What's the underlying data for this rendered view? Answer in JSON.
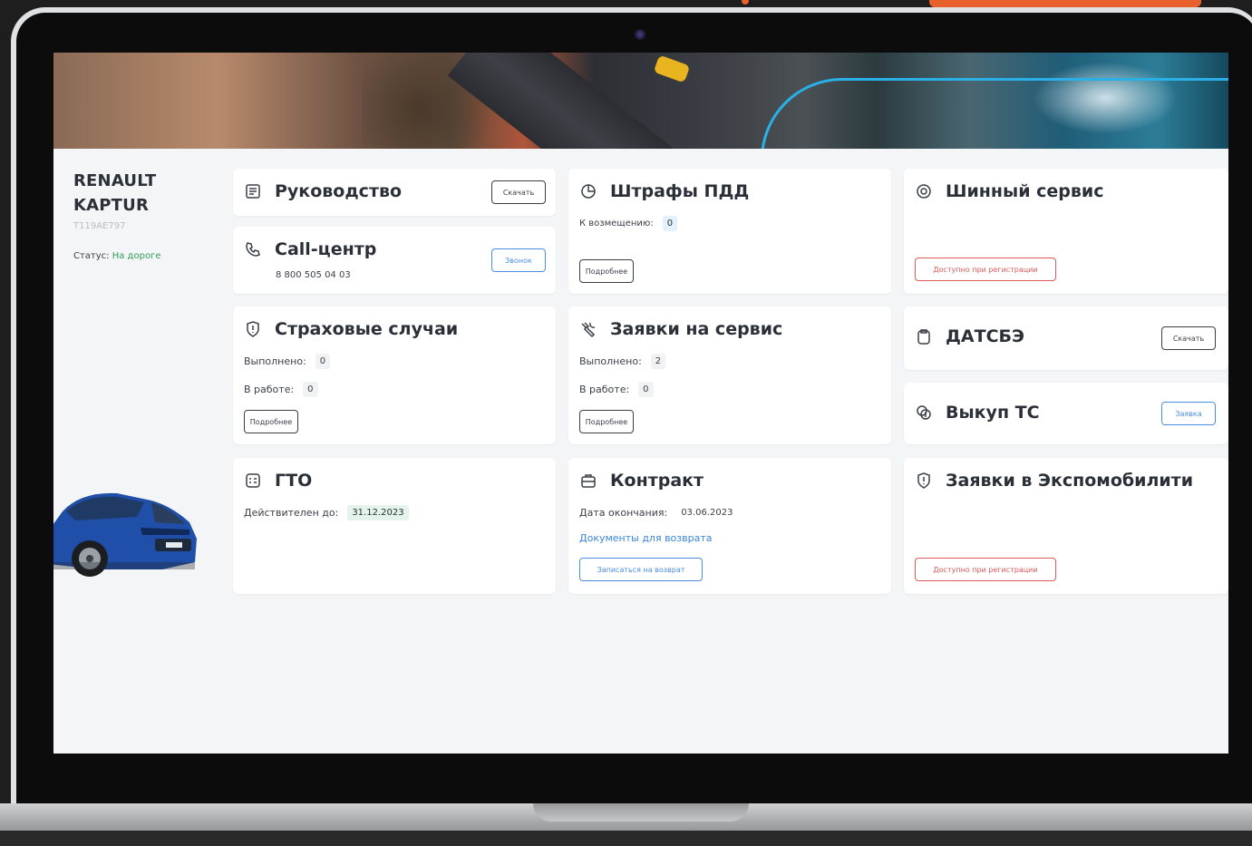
{
  "vehicle": {
    "make": "RENAULT",
    "model": "KAPTUR",
    "plate": "Т119АЕ797",
    "status_label": "Статус:",
    "status_value": "На дороге"
  },
  "cards": {
    "manual": {
      "title": "Руководство",
      "button": "Скачать"
    },
    "callcenter": {
      "title": "Call-центр",
      "phone": "8 800 505 04 03",
      "button": "Звонок"
    },
    "fines": {
      "title": "Штрафы ПДД",
      "refund_label": "К возмещению:",
      "refund_value": "0",
      "button": "Подробнее"
    },
    "tire": {
      "title": "Шинный сервис",
      "button": "Доступно при регистрации"
    },
    "insurance": {
      "title": "Страховые случаи",
      "done_label": "Выполнено:",
      "done_value": "0",
      "work_label": "В работе:",
      "work_value": "0",
      "button": "Подробнее"
    },
    "service": {
      "title": "Заявки на сервис",
      "done_label": "Выполнено:",
      "done_value": "2",
      "work_label": "В работе:",
      "work_value": "0",
      "button": "Подробнее"
    },
    "datsbe": {
      "title": "ДАТСБЭ",
      "button": "Скачать"
    },
    "buyout": {
      "title": "Выкуп ТС",
      "button": "Заявка"
    },
    "gto": {
      "title": "ГТО",
      "valid_label": "Действителен до:",
      "valid_value": "31.12.2023"
    },
    "contract": {
      "title": "Контракт",
      "end_label": "Дата окончания:",
      "end_value": "03.06.2023",
      "docs_link": "Документы для возврата",
      "button": "Записаться на возврат"
    },
    "expo": {
      "title": "Заявки в Экспомобилити",
      "button": "Доступно при регистрации"
    }
  },
  "icons": {
    "manual": "book-icon",
    "callcenter": "phone-icon",
    "fines": "fine-icon",
    "tire": "tire-icon",
    "insurance": "shield-icon",
    "service": "wrench-icon",
    "datsbe": "clipboard-icon",
    "buyout": "coin-icon",
    "gto": "checklist-icon",
    "contract": "briefcase-icon",
    "expo": "shield-alert-icon"
  },
  "colors": {
    "status_green": "#2e9d58",
    "link_blue": "#3a85d8",
    "warn_red": "#e05a5a",
    "accent_orange": "#e8602c"
  }
}
